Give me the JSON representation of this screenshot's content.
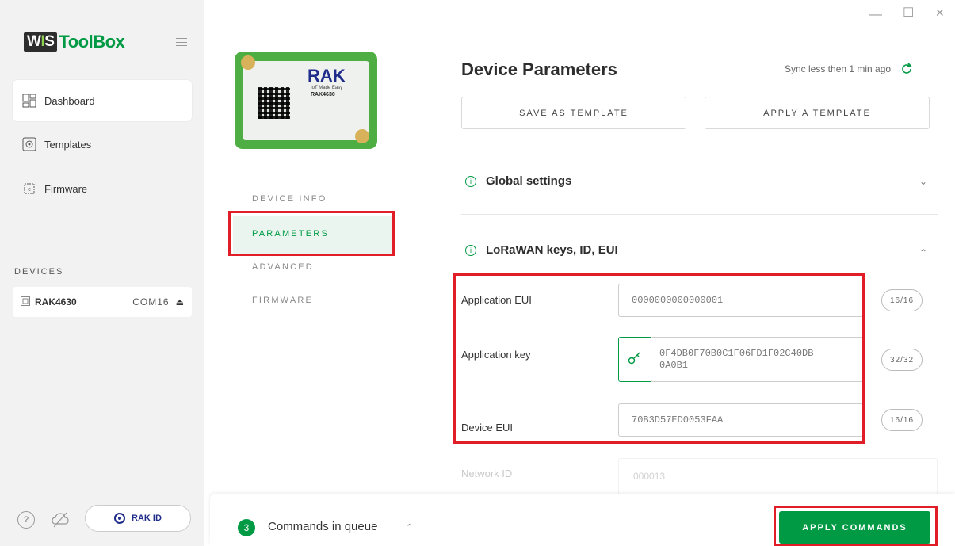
{
  "window": {
    "minimize_glyph": "—",
    "maximize_glyph": "☐",
    "close_glyph": "✕"
  },
  "sidebar": {
    "logo_prefix_w": "W",
    "logo_prefix_i": "I",
    "logo_prefix_s": "S",
    "logo_text": "ToolBox",
    "nav": [
      {
        "label": "Dashboard",
        "icon": "dashboard-grid-icon"
      },
      {
        "label": "Templates",
        "icon": "templates-icon"
      },
      {
        "label": "Firmware",
        "icon": "firmware-chip-icon"
      }
    ],
    "devices_heading": "DEVICES",
    "device": {
      "name": "RAK4630",
      "port": "COM16",
      "eject_glyph": "⏏"
    },
    "help_glyph": "?",
    "rak_id_label": "RAK ID"
  },
  "module": {
    "brand": "RAK",
    "tagline": "IoT Made Easy",
    "model": "RAK4630"
  },
  "tabs": [
    {
      "label": "DEVICE INFO",
      "active": false
    },
    {
      "label": "PARAMETERS",
      "active": true
    },
    {
      "label": "ADVANCED",
      "active": false
    },
    {
      "label": "FIRMWARE",
      "active": false
    }
  ],
  "main": {
    "title": "Device Parameters",
    "sync_text": "Sync less then 1 min ago",
    "save_template_label": "SAVE AS TEMPLATE",
    "apply_template_label": "APPLY A TEMPLATE",
    "global_settings_label": "Global settings",
    "lorawan_label": "LoRaWAN keys, ID, EUI",
    "fields": {
      "app_eui": {
        "label": "Application EUI",
        "value": "0000000000000001",
        "counter": "16/16"
      },
      "app_key": {
        "label": "Application key",
        "value_line1": "0F4DB0F70B0C1F06FD1F02C40DB",
        "value_line2": "0A0B1",
        "counter": "32/32"
      },
      "dev_eui": {
        "label": "Device EUI",
        "value": "70B3D57ED0053FAA",
        "counter": "16/16"
      },
      "network_id": {
        "label": "Network ID",
        "value": "000013"
      }
    }
  },
  "bottom": {
    "queue_count": "3",
    "queue_label": "Commands in queue",
    "apply_commands_label": "APPLY COMMANDS"
  },
  "colors": {
    "accent": "#009a44",
    "highlight_box": "#e11d27",
    "sidebar_bg": "#f2f2f2"
  }
}
